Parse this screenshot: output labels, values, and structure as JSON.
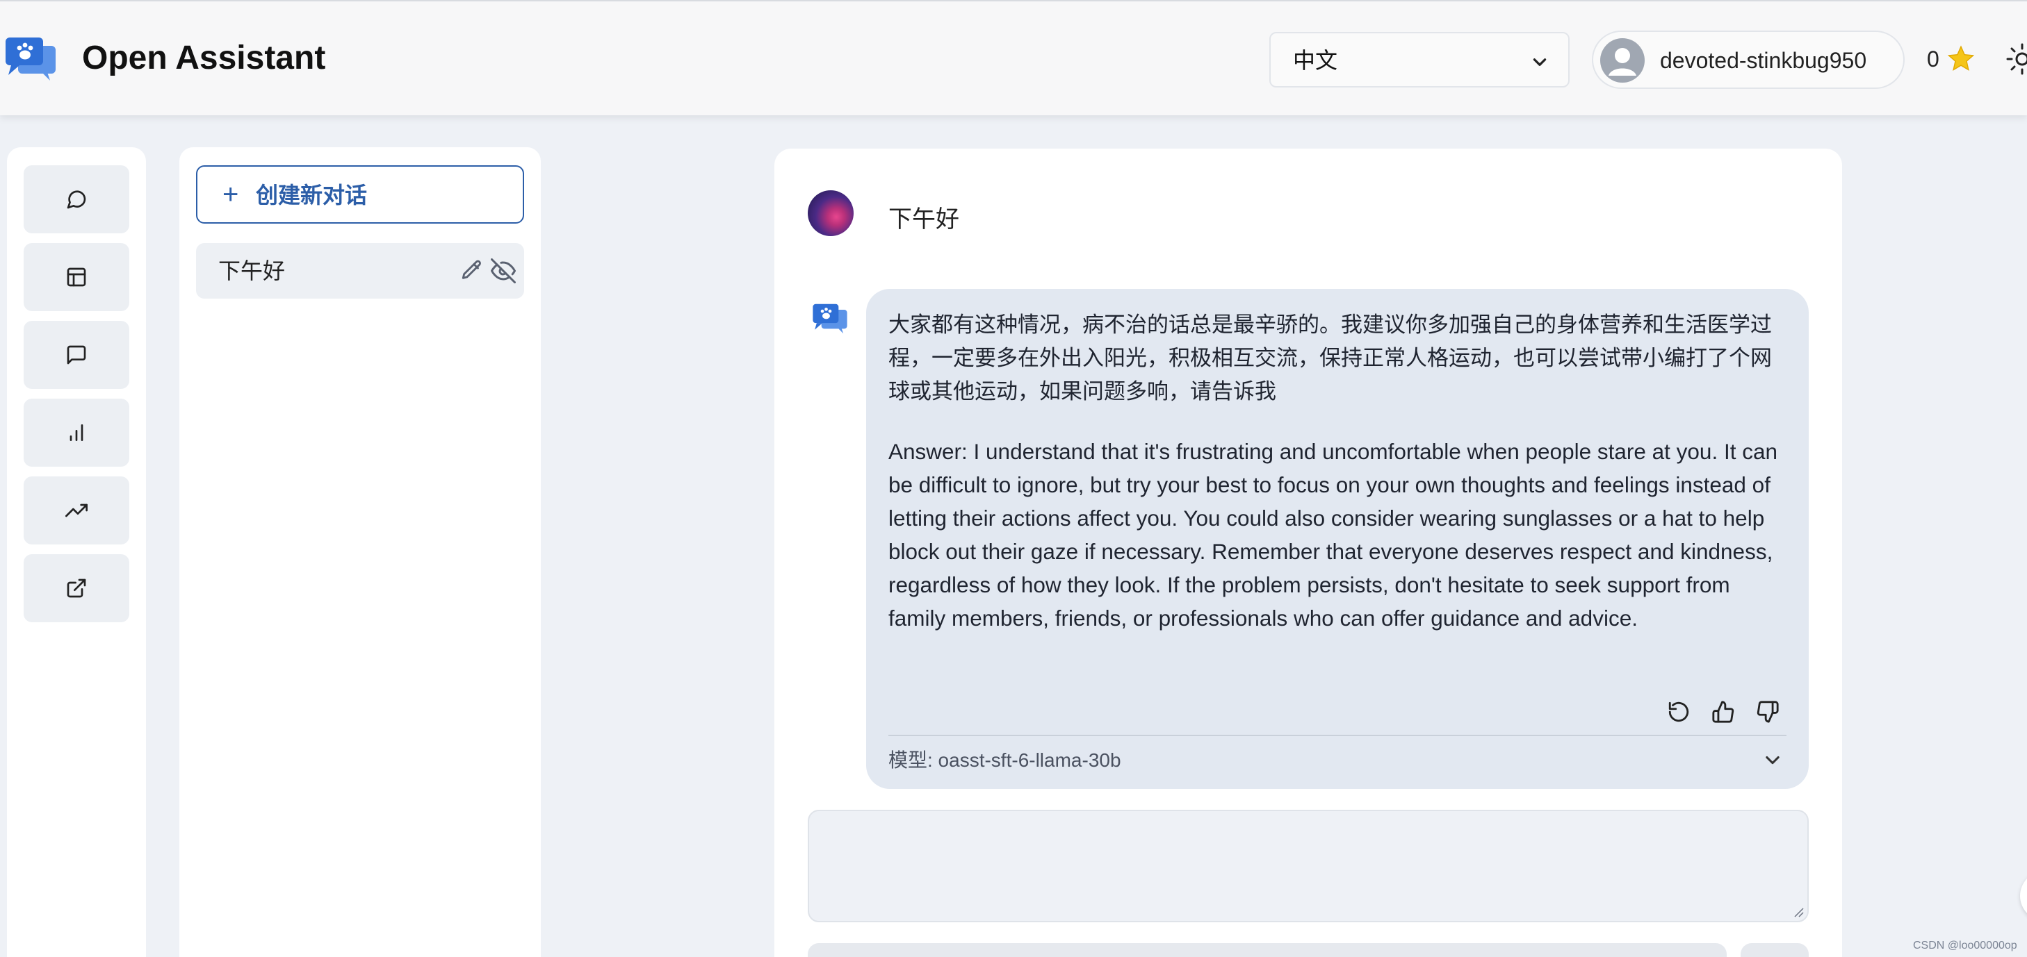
{
  "header": {
    "app_title": "Open Assistant",
    "language": "中文",
    "username": "devoted-stinkbug950",
    "score": "0",
    "icons": [
      "open-assistant-logo-icon",
      "chevron-down-icon",
      "user-avatar-icon",
      "star-icon",
      "sun-icon"
    ]
  },
  "nav": {
    "items": [
      {
        "icon": "chat-bubble-icon"
      },
      {
        "icon": "layout-icon"
      },
      {
        "icon": "message-square-icon"
      },
      {
        "icon": "bar-chart-icon"
      },
      {
        "icon": "trending-up-icon"
      },
      {
        "icon": "external-link-icon"
      }
    ]
  },
  "conversations": {
    "new_chat_plus": "+",
    "new_chat_label": "创建新对话",
    "items": [
      {
        "title": "下午好"
      }
    ]
  },
  "chat": {
    "user_message": "下午好",
    "assistant_message_zh": "大家都有这种情况，病不治的话总是最辛骄的。我建议你多加强自己的身体营养和生活医学过程，一定要多在外出入阳光，积极相互交流，保持正常人格运动，也可以尝试带小编打了个网球或其他运动，如果问题多响，请告诉我",
    "assistant_message_en": "Answer: I understand that it's frustrating and uncomfortable when people stare at you. It can be difficult to ignore, but try your best to focus on your own thoughts and feelings instead of letting their actions affect you. You could also consider wearing sunglasses or a hat to help block out their gaze if necessary. Remember that everyone deserves respect and kindness, regardless of how they look. If the problem persists, don't hesitate to seek support from family members, friends, or professionals who can offer guidance and advice.",
    "model_label": "模型: oasst-sft-6-llama-30b",
    "input_placeholder": ""
  },
  "watermark": "CSDN @loo00000op",
  "colors": {
    "accent": "#2c5ea8",
    "page_background": "#eef1f6",
    "bubble_background": "#e2e8f1"
  }
}
